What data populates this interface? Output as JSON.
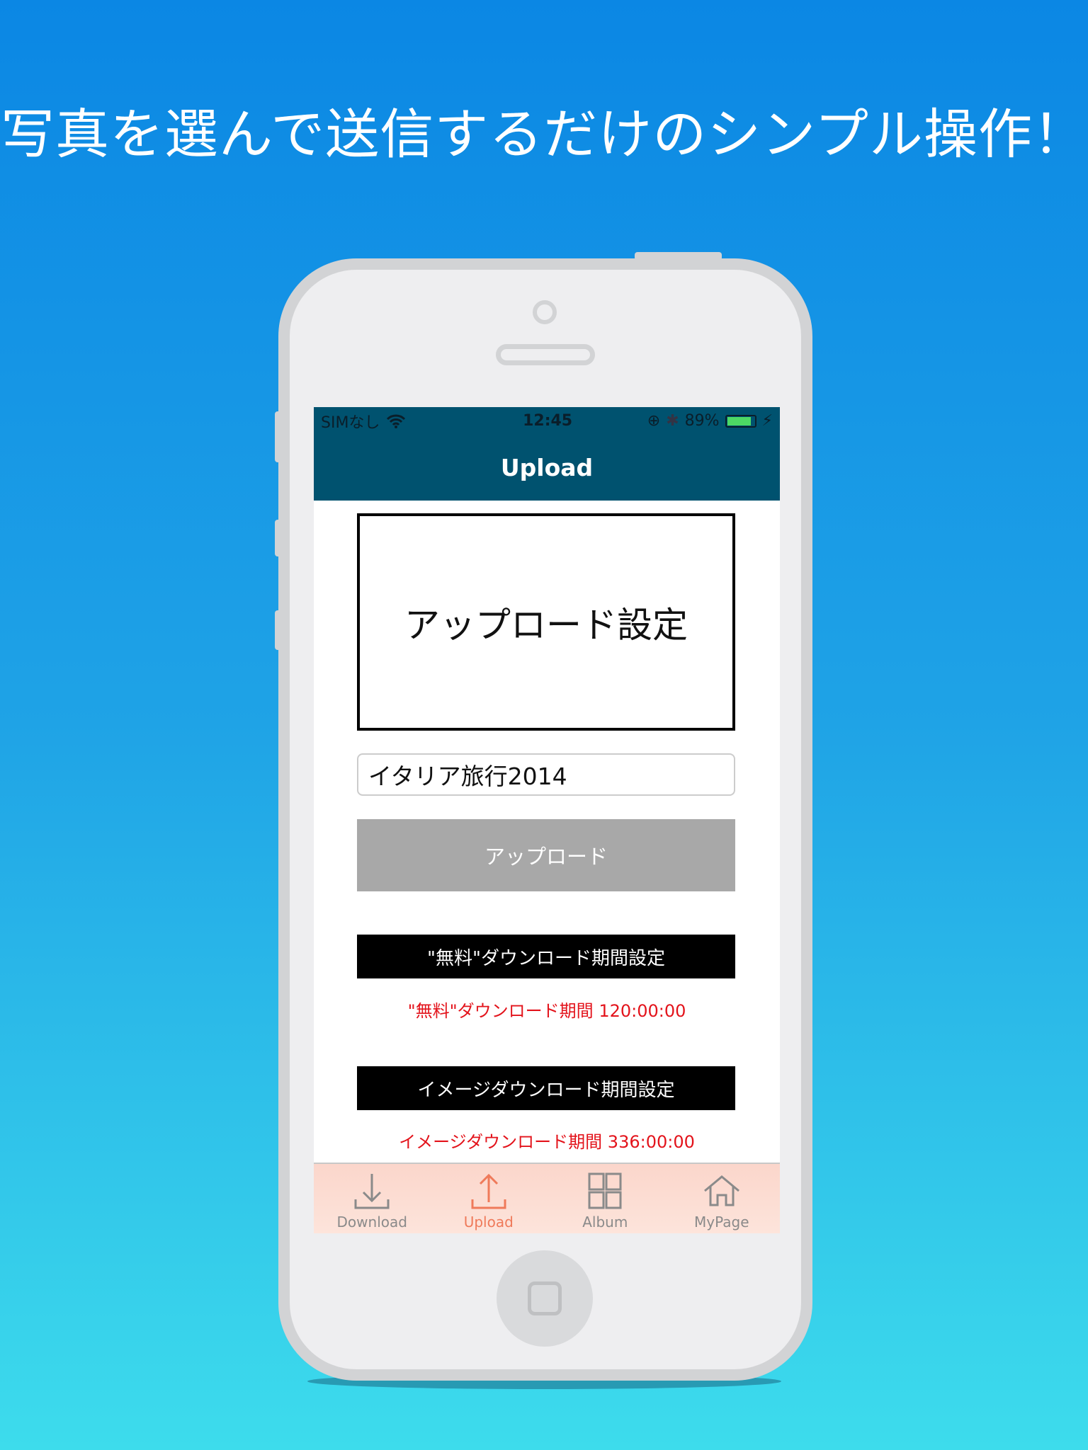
{
  "headline": "写真を選んで送信するだけのシンプル操作！",
  "status_bar": {
    "carrier": "SIMなし",
    "time": "12:45",
    "battery": "89%",
    "battery_level": 0.89,
    "battery_color": "#4cd964"
  },
  "nav": {
    "title": "Upload"
  },
  "content": {
    "settings_box": "アップロード設定",
    "album_name_value": "イタリア旅行2014",
    "upload_button": "アップロード",
    "free_period_button": "\"無料\"ダウンロード期間設定",
    "free_period_text": "\"無料\"ダウンロード期間 120:00:00",
    "image_period_button": "イメージダウンロード期間設定",
    "image_period_text": "イメージダウンロード期間 336:00:00"
  },
  "tabs": [
    {
      "label": "Download",
      "icon": "download-icon"
    },
    {
      "label": "Upload",
      "icon": "upload-icon",
      "active": true
    },
    {
      "label": "Album",
      "icon": "grid-icon"
    },
    {
      "label": "MyPage",
      "icon": "home-icon"
    }
  ],
  "colors": {
    "nav": "#00526f",
    "accent": "#ef7a5a",
    "red": "#e3131b"
  }
}
